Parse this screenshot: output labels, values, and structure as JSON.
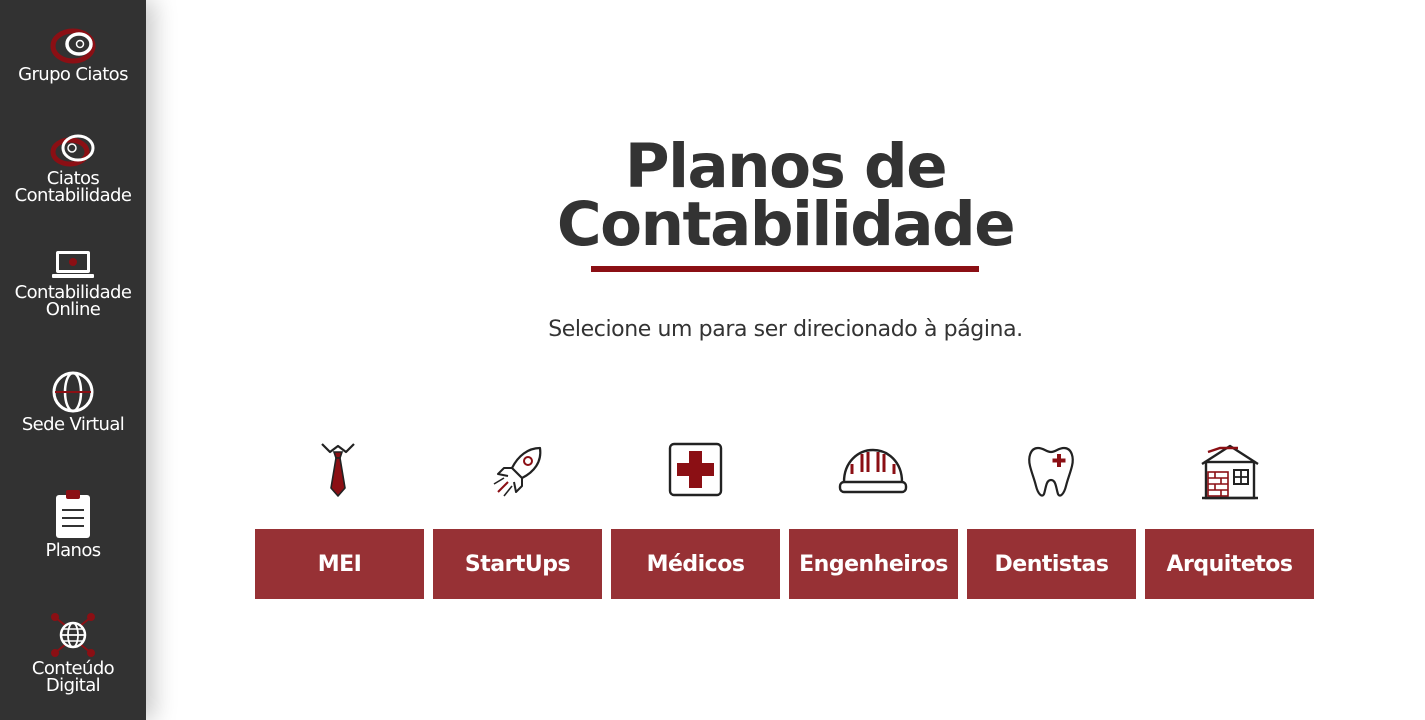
{
  "sidebar": {
    "items": [
      {
        "label_line1": "Grupo Ciatos",
        "label_line2": "",
        "icon": "grupo-ciatos-logo-icon"
      },
      {
        "label_line1": "Ciatos",
        "label_line2": "Contabilidade",
        "icon": "ciatos-contabilidade-logo-icon"
      },
      {
        "label_line1": "Contabilidade",
        "label_line2": "Online",
        "icon": "laptop-icon"
      },
      {
        "label_line1": "Sede Virtual",
        "label_line2": "",
        "icon": "globe-icon"
      },
      {
        "label_line1": "Planos",
        "label_line2": "",
        "icon": "clipboard-icon"
      },
      {
        "label_line1": "Conteúdo",
        "label_line2": "Digital",
        "icon": "network-globe-icon"
      }
    ]
  },
  "main": {
    "title_line1": "Planos de",
    "title_line2": "Contabilidade",
    "subtitle": "Selecione um para ser direcionado à página.",
    "plans": [
      {
        "label": "MEI",
        "icon": "tie-icon"
      },
      {
        "label": "StartUps",
        "icon": "rocket-icon"
      },
      {
        "label": "Médicos",
        "icon": "medical-cross-icon"
      },
      {
        "label": "Engenheiros",
        "icon": "hard-hat-icon"
      },
      {
        "label": "Dentistas",
        "icon": "tooth-icon"
      },
      {
        "label": "Arquitetos",
        "icon": "house-icon"
      }
    ]
  },
  "colors": {
    "sidebar_bg": "#323232",
    "accent": "#8b0f14",
    "button_bg": "#973135",
    "text": "#333333"
  }
}
